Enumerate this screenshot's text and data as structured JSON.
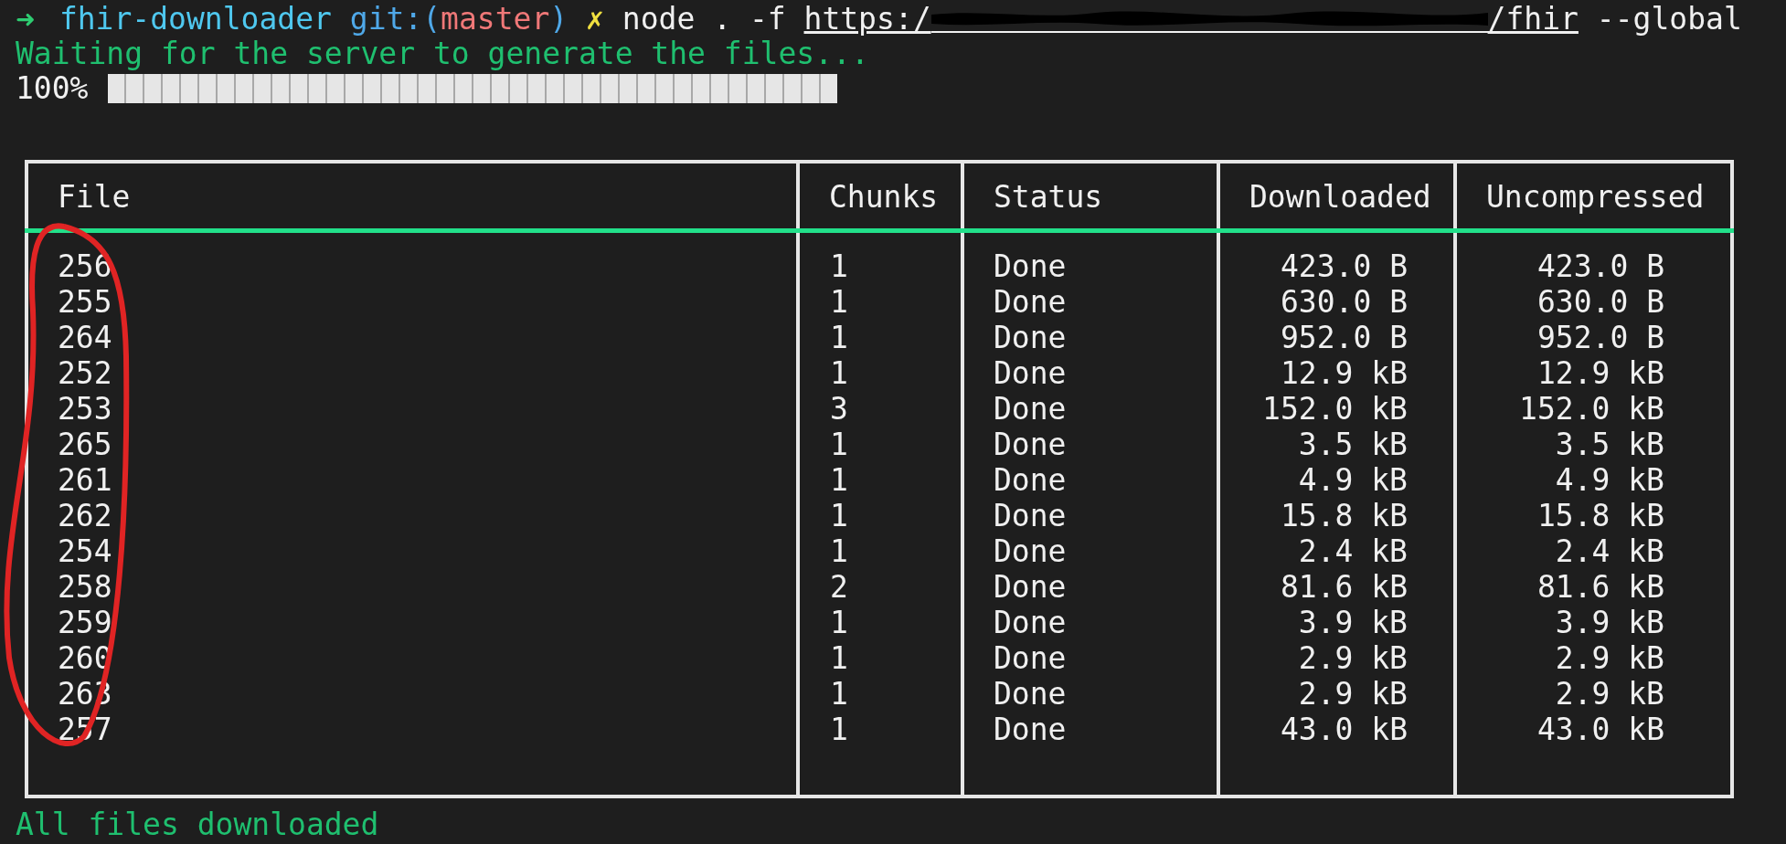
{
  "prompt": {
    "arrow": "➜",
    "directory": "fhir-downloader",
    "git_open": "git:(",
    "branch": "master",
    "git_close": ")",
    "dirty_mark": "✗"
  },
  "command": {
    "program": "node . -f",
    "url_start": "https:/",
    "url_end": "/fhir",
    "flag": "--global"
  },
  "waiting_message": "Waiting for the server to generate the files...",
  "progress": {
    "percent": "100%",
    "level": 1
  },
  "table": {
    "columns": [
      "File",
      "Chunks",
      "Status",
      "Downloaded",
      "Uncompressed"
    ],
    "rows": [
      [
        "256",
        "1",
        "Done",
        "423.0 B",
        "423.0 B"
      ],
      [
        "255",
        "1",
        "Done",
        "630.0 B",
        "630.0 B"
      ],
      [
        "264",
        "1",
        "Done",
        "952.0 B",
        "952.0 B"
      ],
      [
        "252",
        "1",
        "Done",
        "12.9 kB",
        "12.9 kB"
      ],
      [
        "253",
        "3",
        "Done",
        "152.0 kB",
        "152.0 kB"
      ],
      [
        "265",
        "1",
        "Done",
        "3.5 kB",
        "3.5 kB"
      ],
      [
        "261",
        "1",
        "Done",
        "4.9 kB",
        "4.9 kB"
      ],
      [
        "262",
        "1",
        "Done",
        "15.8 kB",
        "15.8 kB"
      ],
      [
        "254",
        "1",
        "Done",
        "2.4 kB",
        "2.4 kB"
      ],
      [
        "258",
        "2",
        "Done",
        "81.6 kB",
        "81.6 kB"
      ],
      [
        "259",
        "1",
        "Done",
        "3.9 kB",
        "3.9 kB"
      ],
      [
        "260",
        "1",
        "Done",
        "2.9 kB",
        "2.9 kB"
      ],
      [
        "263",
        "1",
        "Done",
        "2.9 kB",
        "2.9 kB"
      ],
      [
        "257",
        "1",
        "Done",
        "43.0 kB",
        "43.0 kB"
      ]
    ]
  },
  "done_message": "All files downloaded"
}
